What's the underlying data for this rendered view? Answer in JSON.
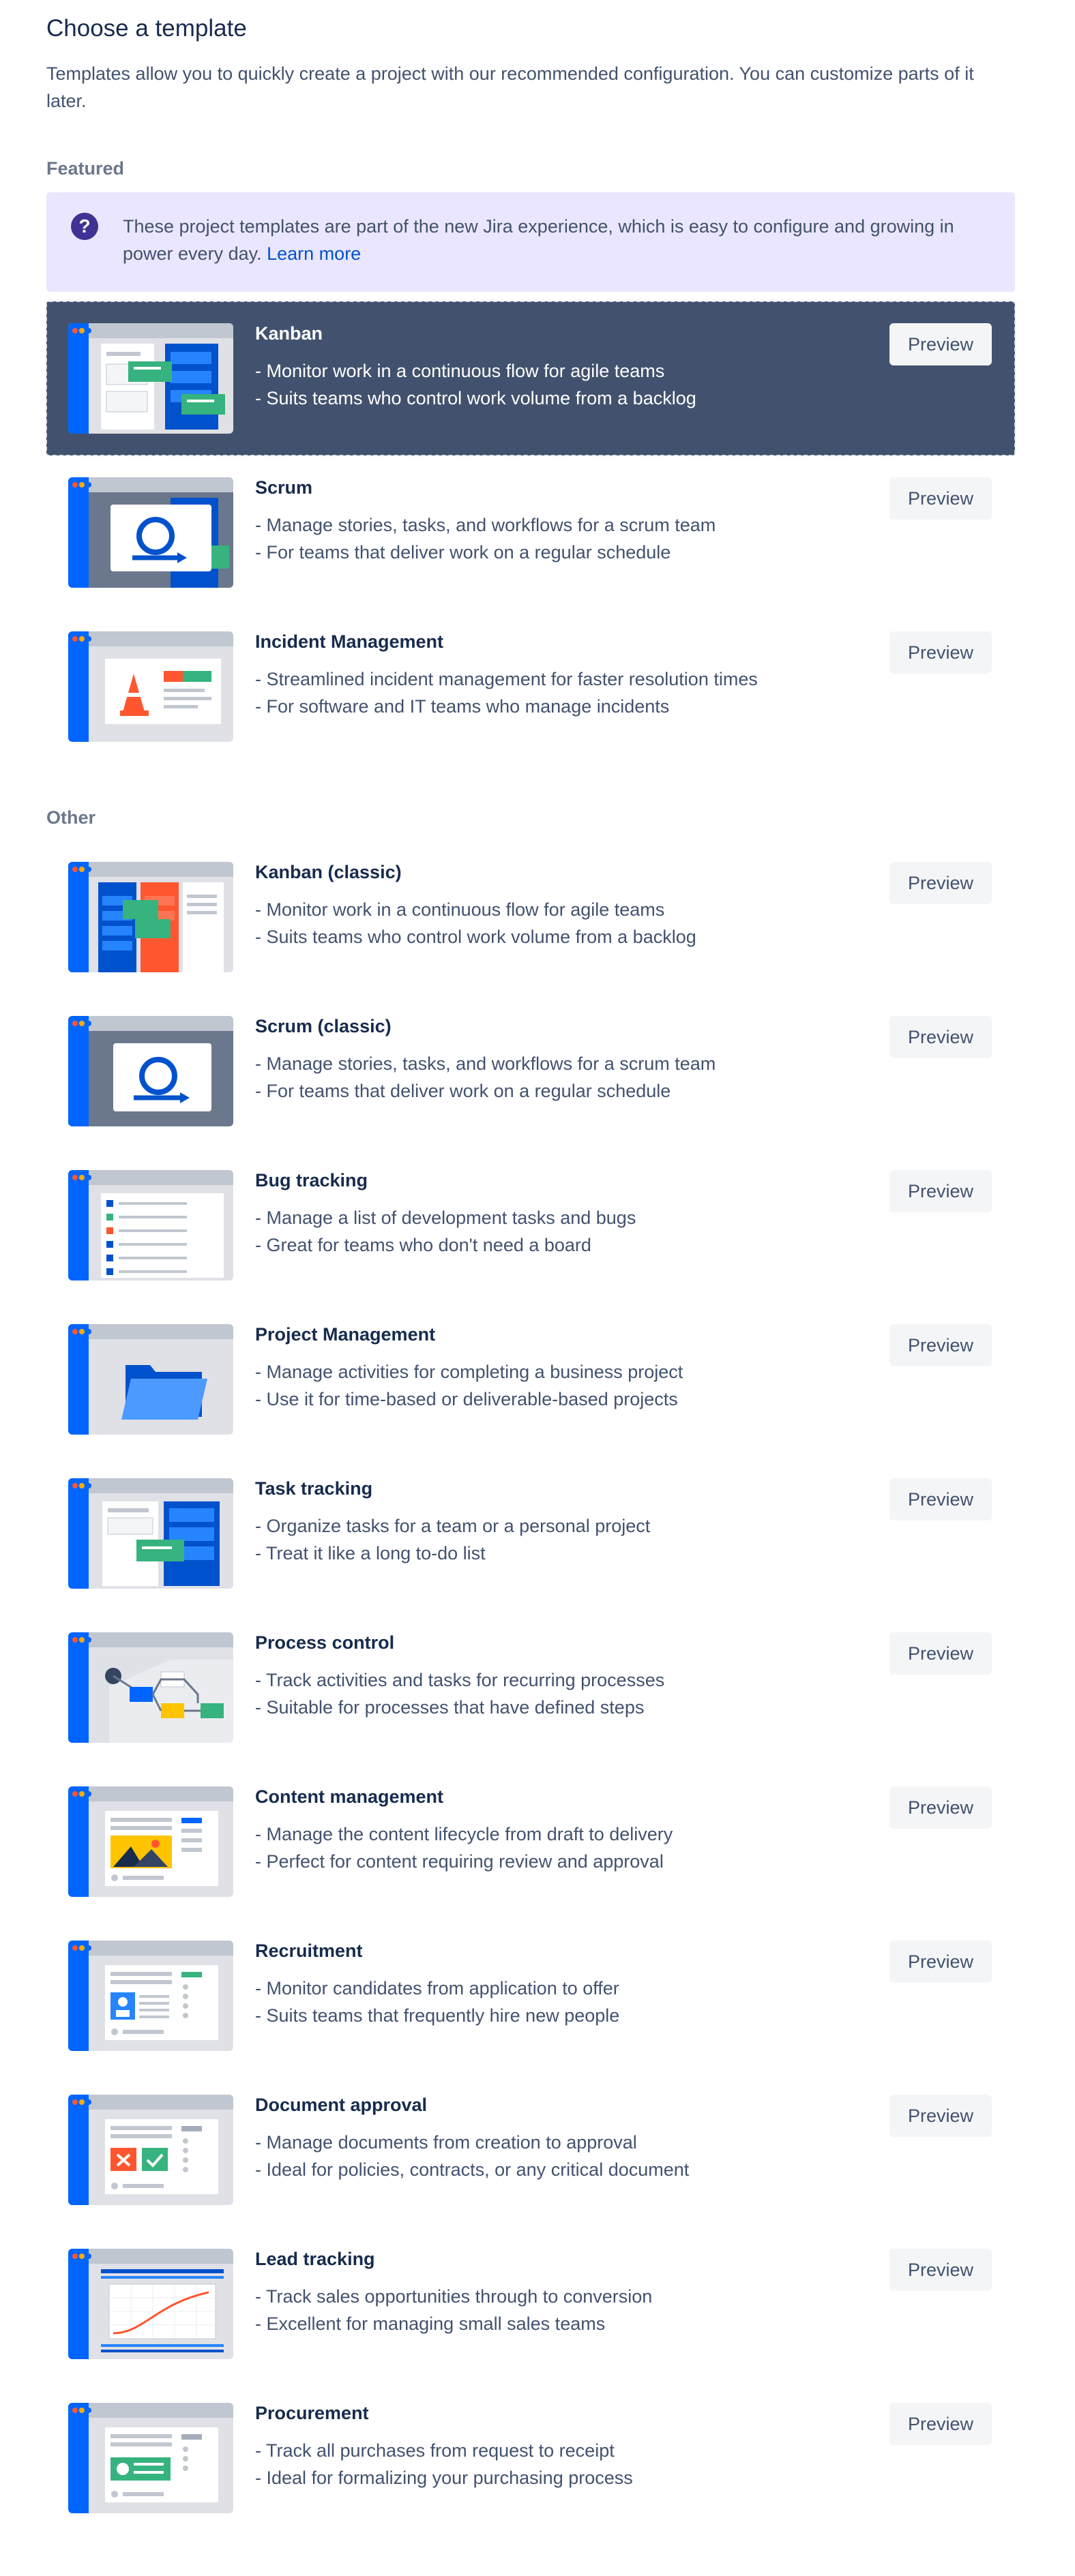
{
  "header": {
    "title": "Choose a template",
    "description": "Templates allow you to quickly create a project with our recommended configuration. You can customize parts of it later."
  },
  "featured": {
    "label": "Featured",
    "info": {
      "text": "These project templates are part of the new Jira experience, which is easy to configure and growing in power every day.",
      "link": "Learn more"
    },
    "items": [
      {
        "name": "Kanban",
        "line1": "- Monitor work in a continuous flow for agile teams",
        "line2": "- Suits teams who control work volume from a backlog",
        "preview": "Preview",
        "thumb": "kanban"
      },
      {
        "name": "Scrum",
        "line1": "- Manage stories, tasks, and workflows for a scrum team",
        "line2": "- For teams that deliver work on a regular schedule",
        "preview": "Preview",
        "thumb": "scrum"
      },
      {
        "name": "Incident Management",
        "line1": "- Streamlined incident management for faster resolution times",
        "line2": "- For software and IT teams who manage incidents",
        "preview": "Preview",
        "thumb": "incident"
      }
    ]
  },
  "other": {
    "label": "Other",
    "items": [
      {
        "name": "Kanban (classic)",
        "line1": "- Monitor work in a continuous flow for agile teams",
        "line2": "- Suits teams who control work volume from a backlog",
        "preview": "Preview",
        "thumb": "kanban-classic"
      },
      {
        "name": "Scrum (classic)",
        "line1": "- Manage stories, tasks, and workflows for a scrum team",
        "line2": "- For teams that deliver work on a regular schedule",
        "preview": "Preview",
        "thumb": "scrum"
      },
      {
        "name": "Bug tracking",
        "line1": "- Manage a list of development tasks and bugs",
        "line2": "- Great for teams who don't need a board",
        "preview": "Preview",
        "thumb": "bug"
      },
      {
        "name": "Project Management",
        "line1": "- Manage activities for completing a business project",
        "line2": "- Use it for time-based or deliverable-based projects",
        "preview": "Preview",
        "thumb": "folder"
      },
      {
        "name": "Task tracking",
        "line1": "- Organize tasks for a team or a personal project",
        "line2": "- Treat it like a long to-do list",
        "preview": "Preview",
        "thumb": "task"
      },
      {
        "name": "Process control",
        "line1": "- Track activities and tasks for recurring processes",
        "line2": "- Suitable for processes that have defined steps",
        "preview": "Preview",
        "thumb": "process"
      },
      {
        "name": "Content management",
        "line1": "- Manage the content lifecycle from draft to delivery",
        "line2": "- Perfect for content requiring review and approval",
        "preview": "Preview",
        "thumb": "content"
      },
      {
        "name": "Recruitment",
        "line1": "- Monitor candidates from application to offer",
        "line2": "- Suits teams that frequently hire new people",
        "preview": "Preview",
        "thumb": "recruit"
      },
      {
        "name": "Document approval",
        "line1": "- Manage documents from creation to approval",
        "line2": "- Ideal for policies, contracts, or any critical document",
        "preview": "Preview",
        "thumb": "document"
      },
      {
        "name": "Lead tracking",
        "line1": "- Track sales opportunities through to conversion",
        "line2": "- Excellent for managing small sales teams",
        "preview": "Preview",
        "thumb": "lead"
      },
      {
        "name": "Procurement",
        "line1": "- Track all purchases from request to receipt",
        "line2": "- Ideal for formalizing your purchasing process",
        "preview": "Preview",
        "thumb": "procure"
      }
    ]
  },
  "colors": {
    "selected_bg": "#42526e",
    "info_bg": "#eae6ff",
    "info_icon": "#403294",
    "link": "#0052cc",
    "accent_blue": "#0065ff"
  }
}
